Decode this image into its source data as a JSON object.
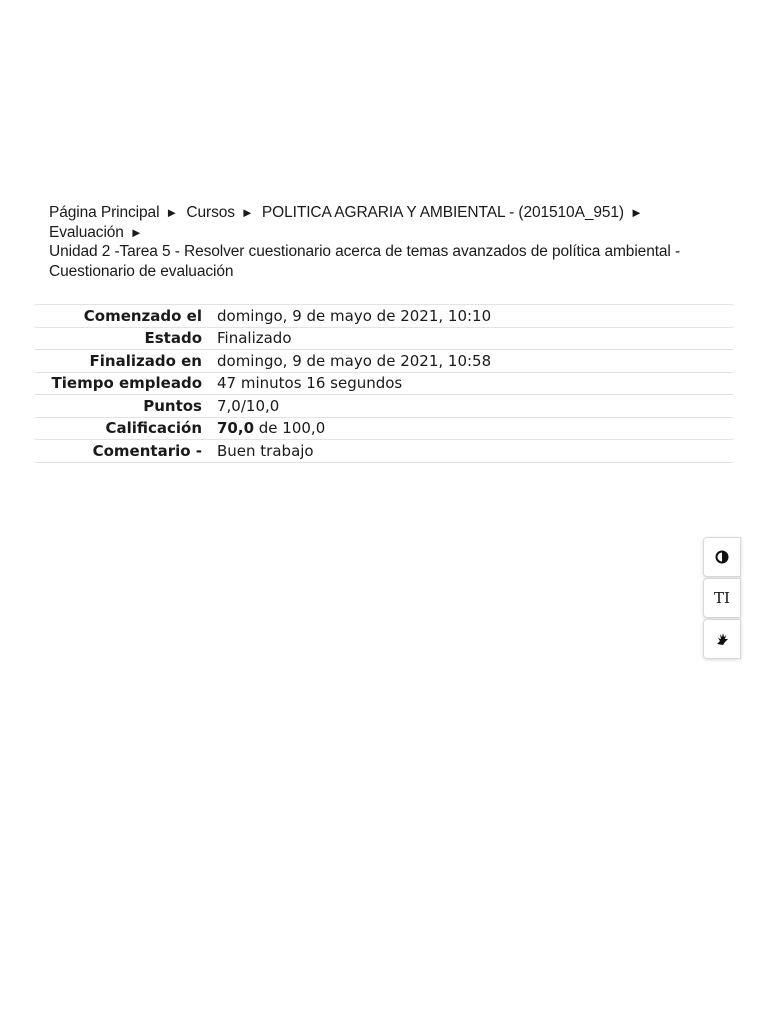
{
  "breadcrumb": {
    "items": [
      "Página Principal",
      "Cursos",
      "POLITICA AGRARIA Y AMBIENTAL - (201510A_951)",
      "Evaluación"
    ],
    "separator": "►",
    "current": "Unidad 2 -Tarea 5 - Resolver cuestionario acerca de temas avanzados de política ambiental - Cuestionario de evaluación"
  },
  "summary": {
    "rows": [
      {
        "label": "Comenzado el",
        "value": "domingo, 9 de mayo de 2021, 10:10"
      },
      {
        "label": "Estado",
        "value": "Finalizado"
      },
      {
        "label": "Finalizado en",
        "value": "domingo, 9 de mayo de 2021, 10:58"
      },
      {
        "label": "Tiempo empleado",
        "value": "47 minutos 16 segundos"
      },
      {
        "label": "Puntos",
        "value": "7,0/10,0"
      },
      {
        "label": "Calificación",
        "value_bold": "70,0",
        "value_rest": " de 100,0"
      },
      {
        "label": "Comentario -",
        "value": "Buen trabajo"
      }
    ]
  },
  "a11y_toolbar": {
    "contrast_icon": "contrast-icon",
    "text_size_label": "TI",
    "sign_language_icon": "sign-language-hand-icon"
  }
}
